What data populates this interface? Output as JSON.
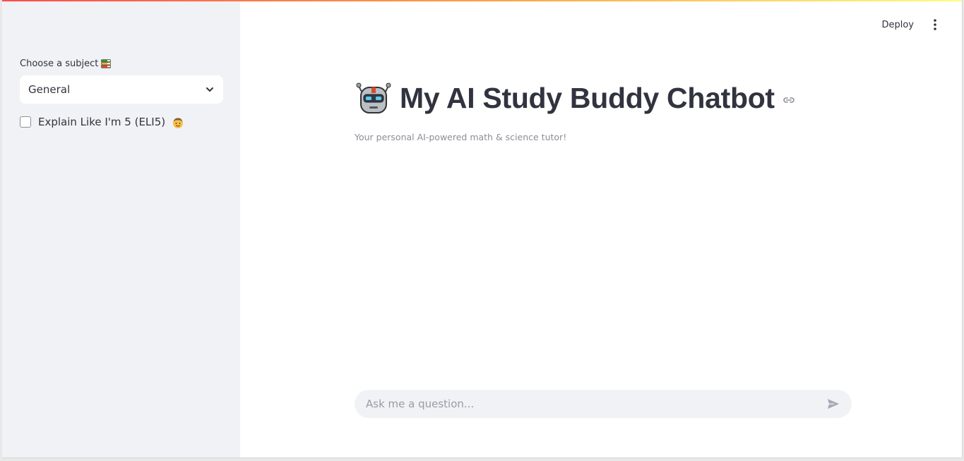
{
  "sidebar": {
    "subject_label": "Choose a subject",
    "subject_icon": "books-icon",
    "subject_value": "General",
    "eli5_label": "Explain Like I'm 5 (ELI5)",
    "eli5_icon": "child-icon",
    "eli5_checked": false
  },
  "toolbar": {
    "deploy_label": "Deploy",
    "menu_icon": "vertical-ellipsis-icon"
  },
  "main": {
    "title_icon": "robot-icon",
    "title": "My AI Study Buddy Chatbot",
    "subtitle": "Your personal AI-powered math & science tutor!"
  },
  "chat": {
    "placeholder": "Ask me a question...",
    "value": ""
  },
  "colors": {
    "sidebar_bg": "#f0f2f6",
    "text": "#31333f",
    "muted": "#8c8d96",
    "accent_red": "#ff4b4b"
  }
}
